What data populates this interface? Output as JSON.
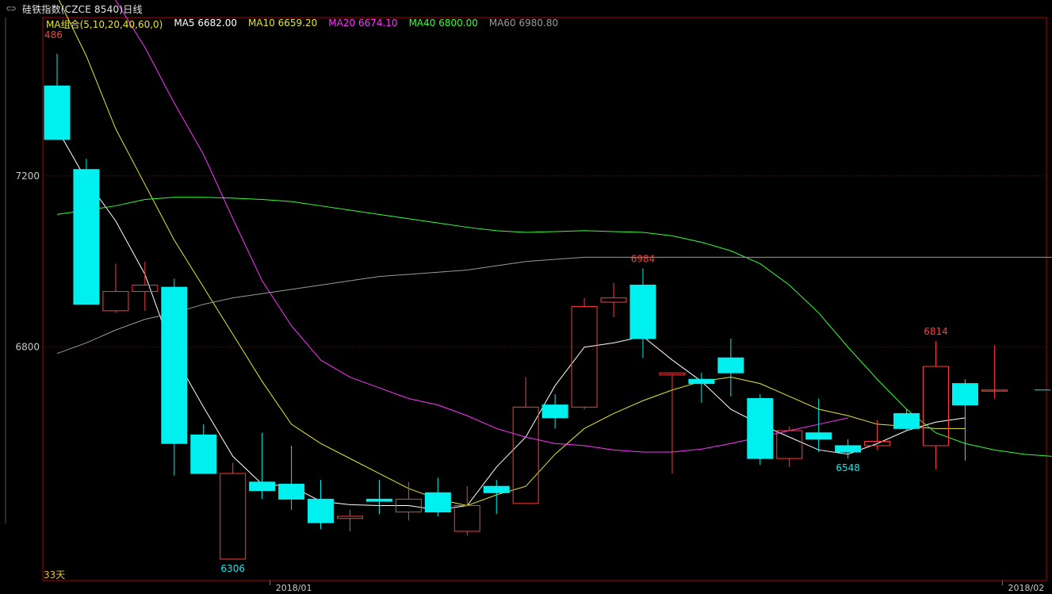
{
  "window": {
    "title": "硅铁指数(CZCE 8540)日线",
    "icon": "link-icon"
  },
  "legend": {
    "group_label": "MA组合(5,10,20,40,60,0)",
    "items": [
      {
        "label": "MA5",
        "value": "6682.00",
        "color": "#ffffff"
      },
      {
        "label": "MA10",
        "value": "6659.20",
        "color": "#e6e62e"
      },
      {
        "label": "MA20",
        "value": "6674.10",
        "color": "#ff33ff"
      },
      {
        "label": "MA40",
        "value": "6800.00",
        "color": "#33ff33"
      },
      {
        "label": "MA60",
        "value": "6980.80",
        "color": "#9a9a9a"
      }
    ]
  },
  "footer": {
    "days_label": "33天"
  },
  "colors": {
    "up": "#ff3b3b",
    "down": "#00f0f0",
    "grid": "#8a0000",
    "axis_text": "#c8c8c8",
    "frame": "#b00000"
  },
  "chart_data": {
    "type": "candlestick",
    "ylim": [
      6255,
      7570
    ],
    "y_ticks": [
      6800,
      7200
    ],
    "x_labels": [
      {
        "index": 7,
        "text": "2018/01"
      },
      {
        "index": 32,
        "text": "2018/02"
      }
    ],
    "top_left_label": "486",
    "candles": [
      {
        "o": 7410,
        "h": 7485,
        "l": 7310,
        "c": 7285
      },
      {
        "o": 7215,
        "h": 7240,
        "l": 6900,
        "c": 6900
      },
      {
        "o": 6885,
        "h": 6995,
        "l": 6880,
        "c": 6930
      },
      {
        "o": 6930,
        "h": 7000,
        "l": 6885,
        "c": 6945
      },
      {
        "o": 6940,
        "h": 6960,
        "l": 6500,
        "c": 6575
      },
      {
        "o": 6595,
        "h": 6620,
        "l": 6535,
        "c": 6505
      },
      {
        "o": 6305,
        "h": 6530,
        "l": 6305,
        "c": 6505
      },
      {
        "o": 6485,
        "h": 6600,
        "l": 6445,
        "c": 6465
      },
      {
        "o": 6480,
        "h": 6570,
        "l": 6420,
        "c": 6445
      },
      {
        "o": 6445,
        "h": 6490,
        "l": 6375,
        "c": 6390
      },
      {
        "o": 6400,
        "h": 6420,
        "l": 6370,
        "c": 6405
      },
      {
        "o": 6445,
        "h": 6490,
        "l": 6410,
        "c": 6440
      },
      {
        "o": 6415,
        "h": 6485,
        "l": 6395,
        "c": 6445
      },
      {
        "o": 6460,
        "h": 6495,
        "l": 6405,
        "c": 6415
      },
      {
        "o": 6370,
        "h": 6475,
        "l": 6360,
        "c": 6430
      },
      {
        "o": 6475,
        "h": 6490,
        "l": 6410,
        "c": 6460
      },
      {
        "o": 6435,
        "h": 6730,
        "l": 6435,
        "c": 6660
      },
      {
        "o": 6665,
        "h": 6690,
        "l": 6610,
        "c": 6635
      },
      {
        "o": 6660,
        "h": 6915,
        "l": 6655,
        "c": 6895
      },
      {
        "o": 6905,
        "h": 6950,
        "l": 6870,
        "c": 6915
      },
      {
        "o": 6945,
        "h": 6984,
        "l": 6775,
        "c": 6820
      },
      {
        "o": 6735,
        "h": 6740,
        "l": 6505,
        "c": 6740
      },
      {
        "o": 6725,
        "h": 6740,
        "l": 6670,
        "c": 6715
      },
      {
        "o": 6775,
        "h": 6820,
        "l": 6685,
        "c": 6740
      },
      {
        "o": 6680,
        "h": 6690,
        "l": 6525,
        "c": 6540
      },
      {
        "o": 6540,
        "h": 6615,
        "l": 6520,
        "c": 6605
      },
      {
        "o": 6600,
        "h": 6680,
        "l": 6555,
        "c": 6585
      },
      {
        "o": 6570,
        "h": 6585,
        "l": 6540,
        "c": 6555
      },
      {
        "o": 6570,
        "h": 6630,
        "l": 6560,
        "c": 6580
      },
      {
        "o": 6645,
        "h": 6655,
        "l": 6605,
        "c": 6610
      },
      {
        "o": 6570,
        "h": 6814,
        "l": 6515,
        "c": 6755
      },
      {
        "o": 6715,
        "h": 6725,
        "l": 6535,
        "c": 6665
      },
      {
        "o": 6700,
        "h": 6805,
        "l": 6680,
        "c": 6700
      }
    ],
    "annotations": [
      {
        "index": 6,
        "kind": "low",
        "text": "6306"
      },
      {
        "index": 20,
        "kind": "high",
        "text": "6984"
      },
      {
        "index": 27,
        "kind": "low",
        "text": "6548"
      },
      {
        "index": 30,
        "kind": "high",
        "text": "6814"
      }
    ],
    "series": [
      {
        "name": "MA5",
        "color": "#ffffff",
        "values": [
          7310,
          7190,
          7095,
          6970,
          6780,
          6660,
          6545,
          6480,
          6475,
          6440,
          6432,
          6430,
          6430,
          6420,
          6430,
          6520,
          6590,
          6710,
          6800,
          6810,
          6825,
          6770,
          6720,
          6655,
          6620,
          6590,
          6560,
          6550,
          6575,
          6605,
          6625,
          6635
        ]
      },
      {
        "name": "MA10",
        "color": "#e6e62e",
        "values": [
          7620,
          7480,
          7310,
          7180,
          7050,
          6940,
          6830,
          6720,
          6620,
          6575,
          6540,
          6505,
          6470,
          6445,
          6430,
          6455,
          6475,
          6550,
          6610,
          6645,
          6675,
          6700,
          6720,
          6730,
          6715,
          6685,
          6655,
          6640,
          6620,
          6615,
          6610,
          6610
        ]
      },
      {
        "name": "MA20",
        "color": "#ff33ff",
        "values": [
          7750,
          7700,
          7610,
          7500,
          7370,
          7250,
          7100,
          6955,
          6850,
          6770,
          6730,
          6705,
          6680,
          6665,
          6640,
          6610,
          6590,
          6575,
          6570,
          6560,
          6555,
          6555,
          6562,
          6575,
          6590,
          6605,
          6620,
          6635
        ]
      },
      {
        "name": "MA40",
        "color": "#33ff33",
        "values": [
          7110,
          7120,
          7130,
          7145,
          7150,
          7150,
          7148,
          7145,
          7140,
          7130,
          7120,
          7110,
          7100,
          7090,
          7080,
          7072,
          7068,
          7070,
          7072,
          7070,
          7068,
          7060,
          7045,
          7025,
          6995,
          6945,
          6880,
          6800,
          6725,
          6655,
          6600,
          6575,
          6560,
          6550,
          6545,
          6540,
          6800
        ]
      },
      {
        "name": "MA60",
        "color": "#9a9a9a",
        "values": [
          6785,
          6810,
          6840,
          6865,
          6880,
          6900,
          6915,
          6925,
          6935,
          6945,
          6955,
          6965,
          6970,
          6975,
          6980,
          6990,
          7000,
          7005,
          7010,
          7010,
          7010,
          7010,
          7010,
          7010,
          7010,
          7010,
          7010,
          7010,
          7010,
          7010,
          7010,
          7010,
          7010,
          7010,
          7010,
          7010,
          7010
        ]
      }
    ]
  }
}
